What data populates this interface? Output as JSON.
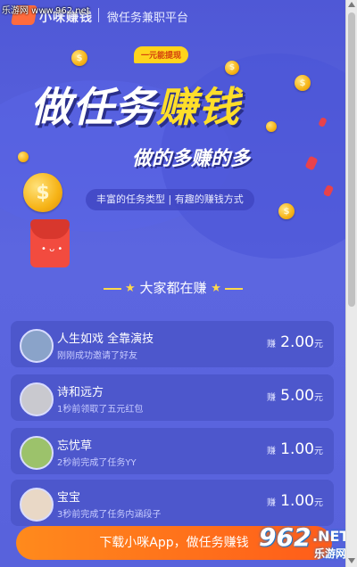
{
  "watermark": {
    "site": "乐游网 www.962.net",
    "logo_number": "962",
    "logo_domain": ".NET",
    "logo_cn": "乐游网"
  },
  "header": {
    "brand": "小咪赚钱",
    "platform": "微任务兼职平台"
  },
  "hero": {
    "badge": "一元能提现",
    "title_a": "做任务",
    "title_b": "赚钱",
    "subtitle": "做的多赚的多",
    "tagline": "丰富的任务类型 | 有趣的赚钱方式"
  },
  "section_title": "大家都在赚",
  "feed": [
    {
      "name": "人生如戏 全靠演技",
      "activity": "刚刚成功邀请了好友",
      "prefix": "赚",
      "amount": "2.00",
      "unit": "元",
      "avatar_color": "#8aa3c9"
    },
    {
      "name": "诗和远方",
      "activity": "1秒前领取了五元红包",
      "prefix": "赚",
      "amount": "5.00",
      "unit": "元",
      "avatar_color": "#c9c9cf"
    },
    {
      "name": "忘忧草",
      "activity": "2秒前完成了任务YY",
      "prefix": "赚",
      "amount": "1.00",
      "unit": "元",
      "avatar_color": "#9cc26b"
    },
    {
      "name": "宝宝",
      "activity": "3秒前完成了任务内涵段子",
      "prefix": "赚",
      "amount": "1.00",
      "unit": "元",
      "avatar_color": "#e9d8c6"
    }
  ],
  "download_button": "下载小咪App，做任务赚钱",
  "colors": {
    "background": "#5a63d8",
    "accent": "#ffde2a",
    "button": "#ff6a1a"
  }
}
